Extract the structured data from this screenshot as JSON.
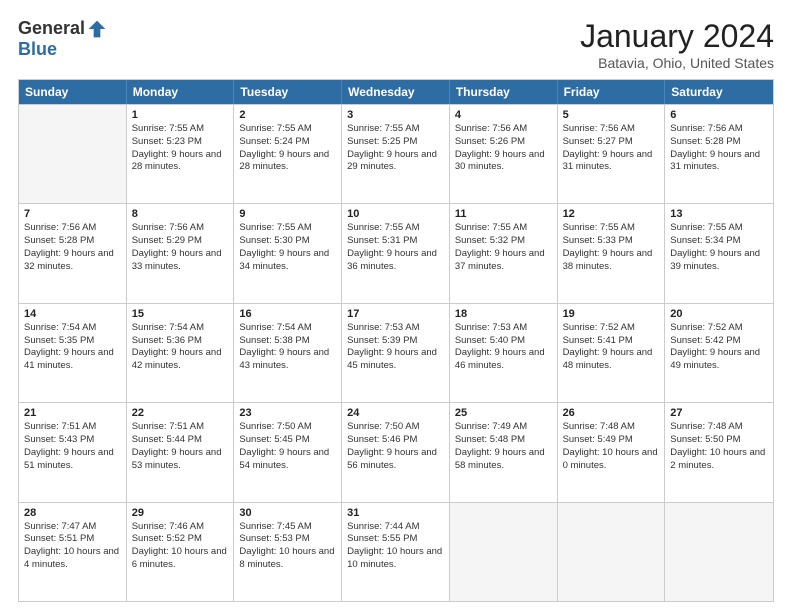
{
  "logo": {
    "general": "General",
    "blue": "Blue"
  },
  "title": "January 2024",
  "location": "Batavia, Ohio, United States",
  "header_days": [
    "Sunday",
    "Monday",
    "Tuesday",
    "Wednesday",
    "Thursday",
    "Friday",
    "Saturday"
  ],
  "weeks": [
    [
      {
        "day": "",
        "sunrise": "",
        "sunset": "",
        "daylight": "",
        "empty": true
      },
      {
        "day": "1",
        "sunrise": "Sunrise: 7:55 AM",
        "sunset": "Sunset: 5:23 PM",
        "daylight": "Daylight: 9 hours and 28 minutes."
      },
      {
        "day": "2",
        "sunrise": "Sunrise: 7:55 AM",
        "sunset": "Sunset: 5:24 PM",
        "daylight": "Daylight: 9 hours and 28 minutes."
      },
      {
        "day": "3",
        "sunrise": "Sunrise: 7:55 AM",
        "sunset": "Sunset: 5:25 PM",
        "daylight": "Daylight: 9 hours and 29 minutes."
      },
      {
        "day": "4",
        "sunrise": "Sunrise: 7:56 AM",
        "sunset": "Sunset: 5:26 PM",
        "daylight": "Daylight: 9 hours and 30 minutes."
      },
      {
        "day": "5",
        "sunrise": "Sunrise: 7:56 AM",
        "sunset": "Sunset: 5:27 PM",
        "daylight": "Daylight: 9 hours and 31 minutes."
      },
      {
        "day": "6",
        "sunrise": "Sunrise: 7:56 AM",
        "sunset": "Sunset: 5:28 PM",
        "daylight": "Daylight: 9 hours and 31 minutes."
      }
    ],
    [
      {
        "day": "7",
        "sunrise": "Sunrise: 7:56 AM",
        "sunset": "Sunset: 5:28 PM",
        "daylight": "Daylight: 9 hours and 32 minutes."
      },
      {
        "day": "8",
        "sunrise": "Sunrise: 7:56 AM",
        "sunset": "Sunset: 5:29 PM",
        "daylight": "Daylight: 9 hours and 33 minutes."
      },
      {
        "day": "9",
        "sunrise": "Sunrise: 7:55 AM",
        "sunset": "Sunset: 5:30 PM",
        "daylight": "Daylight: 9 hours and 34 minutes."
      },
      {
        "day": "10",
        "sunrise": "Sunrise: 7:55 AM",
        "sunset": "Sunset: 5:31 PM",
        "daylight": "Daylight: 9 hours and 36 minutes."
      },
      {
        "day": "11",
        "sunrise": "Sunrise: 7:55 AM",
        "sunset": "Sunset: 5:32 PM",
        "daylight": "Daylight: 9 hours and 37 minutes."
      },
      {
        "day": "12",
        "sunrise": "Sunrise: 7:55 AM",
        "sunset": "Sunset: 5:33 PM",
        "daylight": "Daylight: 9 hours and 38 minutes."
      },
      {
        "day": "13",
        "sunrise": "Sunrise: 7:55 AM",
        "sunset": "Sunset: 5:34 PM",
        "daylight": "Daylight: 9 hours and 39 minutes."
      }
    ],
    [
      {
        "day": "14",
        "sunrise": "Sunrise: 7:54 AM",
        "sunset": "Sunset: 5:35 PM",
        "daylight": "Daylight: 9 hours and 41 minutes."
      },
      {
        "day": "15",
        "sunrise": "Sunrise: 7:54 AM",
        "sunset": "Sunset: 5:36 PM",
        "daylight": "Daylight: 9 hours and 42 minutes."
      },
      {
        "day": "16",
        "sunrise": "Sunrise: 7:54 AM",
        "sunset": "Sunset: 5:38 PM",
        "daylight": "Daylight: 9 hours and 43 minutes."
      },
      {
        "day": "17",
        "sunrise": "Sunrise: 7:53 AM",
        "sunset": "Sunset: 5:39 PM",
        "daylight": "Daylight: 9 hours and 45 minutes."
      },
      {
        "day": "18",
        "sunrise": "Sunrise: 7:53 AM",
        "sunset": "Sunset: 5:40 PM",
        "daylight": "Daylight: 9 hours and 46 minutes."
      },
      {
        "day": "19",
        "sunrise": "Sunrise: 7:52 AM",
        "sunset": "Sunset: 5:41 PM",
        "daylight": "Daylight: 9 hours and 48 minutes."
      },
      {
        "day": "20",
        "sunrise": "Sunrise: 7:52 AM",
        "sunset": "Sunset: 5:42 PM",
        "daylight": "Daylight: 9 hours and 49 minutes."
      }
    ],
    [
      {
        "day": "21",
        "sunrise": "Sunrise: 7:51 AM",
        "sunset": "Sunset: 5:43 PM",
        "daylight": "Daylight: 9 hours and 51 minutes."
      },
      {
        "day": "22",
        "sunrise": "Sunrise: 7:51 AM",
        "sunset": "Sunset: 5:44 PM",
        "daylight": "Daylight: 9 hours and 53 minutes."
      },
      {
        "day": "23",
        "sunrise": "Sunrise: 7:50 AM",
        "sunset": "Sunset: 5:45 PM",
        "daylight": "Daylight: 9 hours and 54 minutes."
      },
      {
        "day": "24",
        "sunrise": "Sunrise: 7:50 AM",
        "sunset": "Sunset: 5:46 PM",
        "daylight": "Daylight: 9 hours and 56 minutes."
      },
      {
        "day": "25",
        "sunrise": "Sunrise: 7:49 AM",
        "sunset": "Sunset: 5:48 PM",
        "daylight": "Daylight: 9 hours and 58 minutes."
      },
      {
        "day": "26",
        "sunrise": "Sunrise: 7:48 AM",
        "sunset": "Sunset: 5:49 PM",
        "daylight": "Daylight: 10 hours and 0 minutes."
      },
      {
        "day": "27",
        "sunrise": "Sunrise: 7:48 AM",
        "sunset": "Sunset: 5:50 PM",
        "daylight": "Daylight: 10 hours and 2 minutes."
      }
    ],
    [
      {
        "day": "28",
        "sunrise": "Sunrise: 7:47 AM",
        "sunset": "Sunset: 5:51 PM",
        "daylight": "Daylight: 10 hours and 4 minutes."
      },
      {
        "day": "29",
        "sunrise": "Sunrise: 7:46 AM",
        "sunset": "Sunset: 5:52 PM",
        "daylight": "Daylight: 10 hours and 6 minutes."
      },
      {
        "day": "30",
        "sunrise": "Sunrise: 7:45 AM",
        "sunset": "Sunset: 5:53 PM",
        "daylight": "Daylight: 10 hours and 8 minutes."
      },
      {
        "day": "31",
        "sunrise": "Sunrise: 7:44 AM",
        "sunset": "Sunset: 5:55 PM",
        "daylight": "Daylight: 10 hours and 10 minutes."
      },
      {
        "day": "",
        "sunrise": "",
        "sunset": "",
        "daylight": "",
        "empty": true
      },
      {
        "day": "",
        "sunrise": "",
        "sunset": "",
        "daylight": "",
        "empty": true
      },
      {
        "day": "",
        "sunrise": "",
        "sunset": "",
        "daylight": "",
        "empty": true
      }
    ]
  ]
}
